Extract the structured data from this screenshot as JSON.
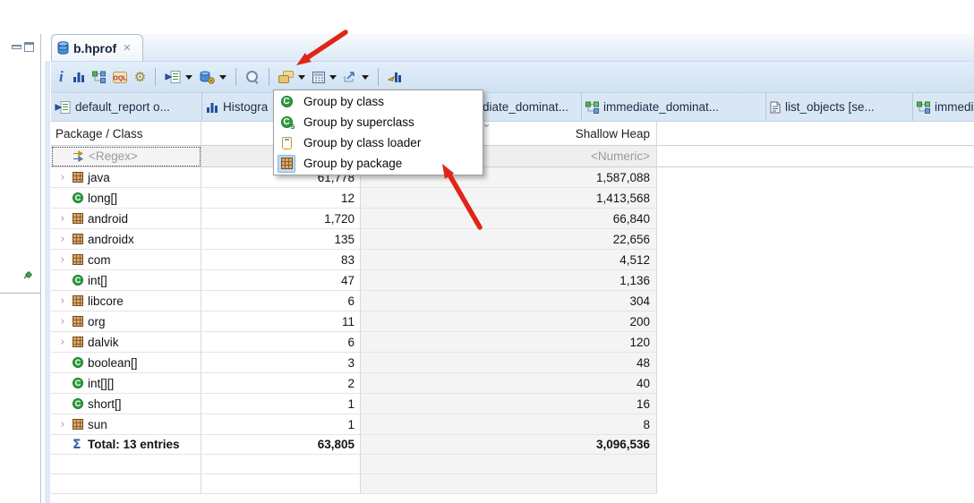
{
  "window": {
    "editor_tab": "b.hprof",
    "close_glyph": "✕"
  },
  "toolbar": {
    "info_glyph": "i",
    "buttons": [
      "info",
      "histogram",
      "dominator-tree",
      "oql",
      "customize-retained-sets",
      "run-expert-report",
      "acquire-heap-dump",
      "search",
      "group-by",
      "calculator",
      "export",
      "compare"
    ]
  },
  "view_tabs": [
    {
      "label": "default_report o...",
      "icon": "report"
    },
    {
      "label": "Histogra",
      "icon": "histogram"
    },
    {
      "label": "diate_dominat...",
      "icon": ""
    },
    {
      "label": "immediate_dominat...",
      "icon": "tree"
    },
    {
      "label": "list_objects  [se...",
      "icon": "page"
    },
    {
      "label": "immediate",
      "icon": "tree"
    }
  ],
  "context_menu": {
    "items": [
      {
        "label": "Group by class",
        "icon": "class",
        "checked": false
      },
      {
        "label": "Group by superclass",
        "icon": "superclass",
        "checked": false
      },
      {
        "label": "Group by class loader",
        "icon": "classloader",
        "checked": false
      },
      {
        "label": "Group by package",
        "icon": "package",
        "checked": true
      }
    ]
  },
  "table": {
    "columns": [
      {
        "label": "Package / Class"
      },
      {
        "label": ""
      },
      {
        "label": "Shallow Heap"
      }
    ],
    "sort": {
      "column": "Shallow Heap",
      "direction": "desc",
      "glyph": "⌄"
    },
    "filter_row": {
      "package_class": "<Regex>",
      "shallow_heap": "<Numeric>"
    },
    "expander_glyph": "›",
    "rows": [
      {
        "name": "java",
        "type": "package",
        "expandable": true,
        "objects": "61,778",
        "shallow_heap": "1,587,088"
      },
      {
        "name": "long[]",
        "type": "class",
        "expandable": false,
        "objects": "12",
        "shallow_heap": "1,413,568"
      },
      {
        "name": "android",
        "type": "package",
        "expandable": true,
        "objects": "1,720",
        "shallow_heap": "66,840"
      },
      {
        "name": "androidx",
        "type": "package",
        "expandable": true,
        "objects": "135",
        "shallow_heap": "22,656"
      },
      {
        "name": "com",
        "type": "package",
        "expandable": true,
        "objects": "83",
        "shallow_heap": "4,512"
      },
      {
        "name": "int[]",
        "type": "class",
        "expandable": false,
        "objects": "47",
        "shallow_heap": "1,136"
      },
      {
        "name": "libcore",
        "type": "package",
        "expandable": true,
        "objects": "6",
        "shallow_heap": "304"
      },
      {
        "name": "org",
        "type": "package",
        "expandable": true,
        "objects": "11",
        "shallow_heap": "200"
      },
      {
        "name": "dalvik",
        "type": "package",
        "expandable": true,
        "objects": "6",
        "shallow_heap": "120"
      },
      {
        "name": "boolean[]",
        "type": "class",
        "expandable": false,
        "objects": "3",
        "shallow_heap": "48"
      },
      {
        "name": "int[][]",
        "type": "class",
        "expandable": false,
        "objects": "2",
        "shallow_heap": "40"
      },
      {
        "name": "short[]",
        "type": "class",
        "expandable": false,
        "objects": "1",
        "shallow_heap": "16"
      },
      {
        "name": "sun",
        "type": "package",
        "expandable": true,
        "objects": "1",
        "shallow_heap": "8"
      }
    ],
    "total_row": {
      "sigma": "Σ",
      "label": "Total: 13 entries",
      "objects": "63,805",
      "shallow_heap": "3,096,536"
    }
  },
  "colors": {
    "toolbar_bg": "#d5e4f3",
    "tabbar_bg": "#d9e7f5",
    "menu_check_highlight": "#bcdcf6",
    "arrow_red": "#e02518",
    "sorted_column_bg": "#f4f4f4",
    "filter_text": "#9b9b9b"
  }
}
